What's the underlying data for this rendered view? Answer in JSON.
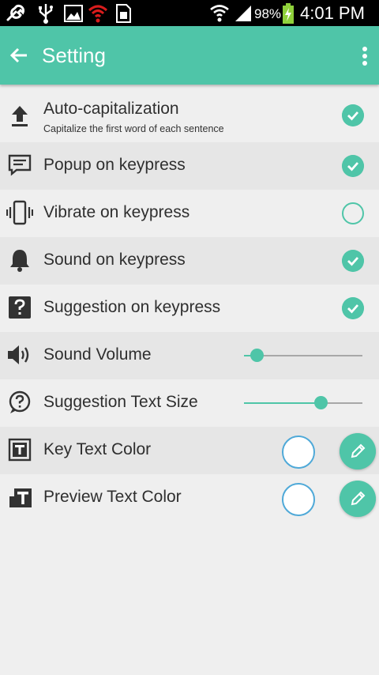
{
  "status_bar": {
    "battery_percent": "98%",
    "time": "4:01 PM",
    "icons": [
      "wrench-icon",
      "usb-icon",
      "image-icon",
      "wifi-alert-icon",
      "sim-card-icon",
      "wifi-icon",
      "signal-icon",
      "battery-charging-icon"
    ]
  },
  "app_bar": {
    "title": "Setting",
    "back_icon": "arrow-back-icon",
    "menu_icon": "more-vert-icon"
  },
  "colors": {
    "accent": "#4fc5a8",
    "background": "#efefef",
    "row_alt": "#e6e6e6",
    "swatch_border": "#4fa9d8"
  },
  "settings": {
    "auto_cap": {
      "label": "Auto-capitalization",
      "sub": "Capitalize the first word of each sentence",
      "checked": true,
      "icon": "upload-icon"
    },
    "popup": {
      "label": "Popup on keypress",
      "checked": true,
      "icon": "message-icon"
    },
    "vibrate": {
      "label": "Vibrate on keypress",
      "checked": false,
      "icon": "vibrate-icon"
    },
    "sound": {
      "label": "Sound on keypress",
      "checked": true,
      "icon": "bell-icon"
    },
    "suggestion": {
      "label": "Suggestion on keypress",
      "checked": true,
      "icon": "help-box-icon"
    },
    "volume": {
      "label": "Sound Volume",
      "value_fraction": 0.11,
      "icon": "speaker-icon"
    },
    "suggest_size": {
      "label": "Suggestion Text Size",
      "value_fraction": 0.65,
      "icon": "help-bubble-icon"
    },
    "key_color": {
      "label": "Key Text Color",
      "color": "#ffffff",
      "icon": "text-box-icon"
    },
    "preview_color": {
      "label": "Preview Text Color",
      "color": "#ffffff",
      "icon": "text-preview-icon"
    }
  }
}
